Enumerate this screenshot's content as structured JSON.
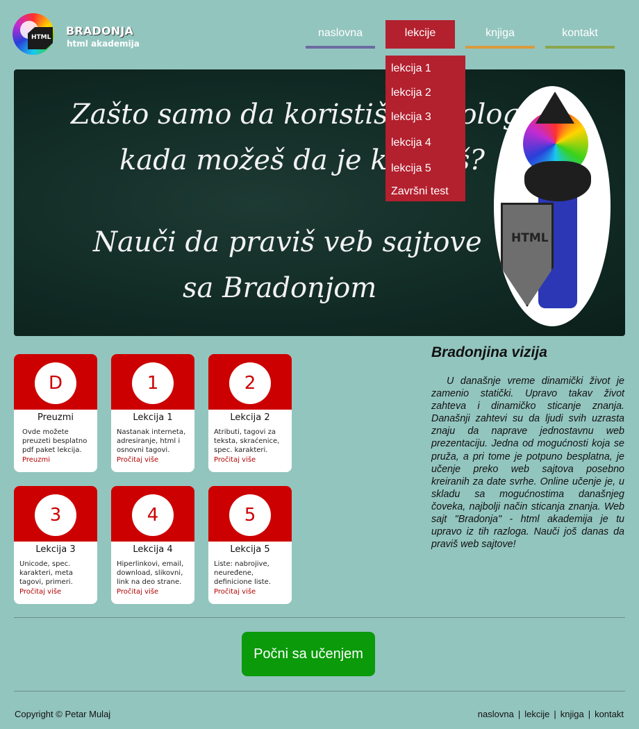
{
  "header": {
    "brand": "BRADONJA",
    "subtitle": "html akademija",
    "logo_text": "HTML"
  },
  "nav": {
    "items": [
      {
        "label": "naslovna",
        "accent": "#6b6ba0"
      },
      {
        "label": "lekcije",
        "accent": "#b3202e",
        "active": true
      },
      {
        "label": "knjiga",
        "accent": "#d99a3c"
      },
      {
        "label": "kontakt",
        "accent": "#8aa64c"
      }
    ]
  },
  "dropdown": {
    "items": [
      "lekcija 1",
      "lekcija 2",
      "lekcija 3",
      "lekcija 4",
      "lekcija 5",
      "Završni test"
    ]
  },
  "hero": {
    "line1": "Zašto samo da koristiš tehnologiju",
    "line2": "kada možeš da je kreiraš?",
    "line3": "Nauči da praviš veb sajtove",
    "line4": "sa Bradonjom",
    "shield_text": "HTML"
  },
  "cards": [
    {
      "badge": "D",
      "title": "Preuzmi",
      "desc": "Ovde možete preuzeti besplatno pdf paket lekcija.",
      "link": "Preuzmi"
    },
    {
      "badge": "1",
      "title": "Lekcija 1",
      "desc": "Nastanak interneta, adresiranje, html i osnovni tagovi.",
      "link": "Pročitaj više"
    },
    {
      "badge": "2",
      "title": "Lekcija 2",
      "desc": "Atributi, tagovi za teksta, skraćenice, spec. karakteri.",
      "link": "Pročitaj više"
    },
    {
      "badge": "3",
      "title": "Lekcija 3",
      "desc": "Unicode, spec. karakteri, meta tagovi, primeri.",
      "link": "Pročitaj više"
    },
    {
      "badge": "4",
      "title": "Lekcija 4",
      "desc": "Hiperlinkovi, email, download, slikovni, link na deo strane.",
      "link": "Pročitaj više"
    },
    {
      "badge": "5",
      "title": "Lekcija 5",
      "desc": "Liste: nabrojive, neuređene, definicione liste.",
      "link": "Pročitaj više"
    }
  ],
  "vision": {
    "title": "Bradonjina vizija",
    "text": "U današnje vreme dinamički život je zamenio statički. Upravo takav život zahteva i dinamičko sticanje znanja. Današnji zahtevi su da ljudi svih uzrasta znaju da naprave jednostavnu web prezentaciju. Jedna od mogućnosti koja se pruža, a pri tome je potpuno besplatna, je učenje preko web sajtova posebno kreiranih za date svrhe. Online učenje je, u skladu sa mogućnostima današnjeg čoveka, najbolji način sticanja znanja. Web sajt \"Bradonja\" - html akademija je tu upravo iz tih razloga. Nauči još danas da praviš web sajtove!"
  },
  "cta": {
    "label": "Počni sa učenjem"
  },
  "footer": {
    "copyright": "Copyright © Petar Mulaj",
    "links": [
      "naslovna",
      "lekcije",
      "knjiga",
      "kontakt"
    ],
    "separator": "|"
  },
  "colors": {
    "background": "#93c5bf",
    "accent_red": "#b3202e",
    "card_red": "#cc0000",
    "cta_green": "#0a9a0a"
  }
}
